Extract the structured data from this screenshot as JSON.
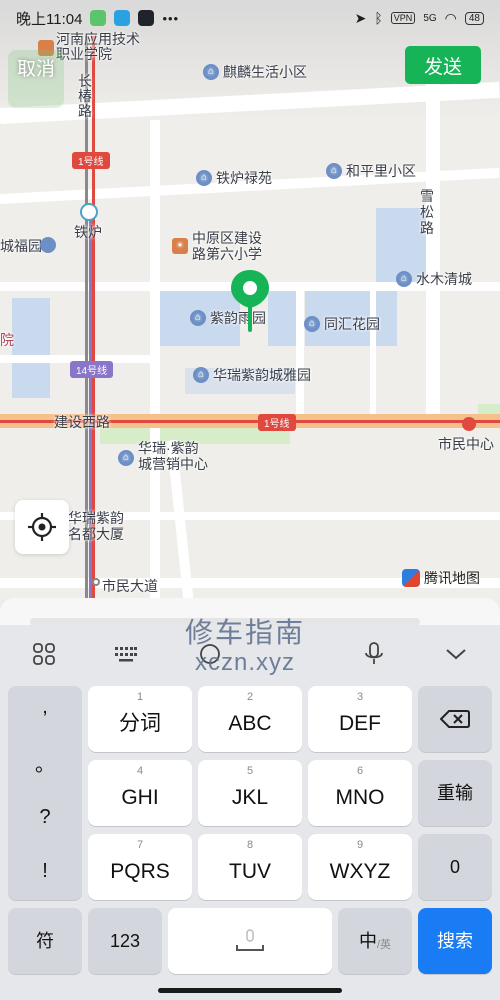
{
  "status_bar": {
    "time": "晚上11:04",
    "dots": "•••",
    "vpn": "VPN",
    "signal": "5G",
    "battery": "48"
  },
  "header": {
    "cancel_label": "取消",
    "send_label": "发送"
  },
  "map": {
    "labels": {
      "school1": "河南应用技术\n职业学院",
      "changchun_road": "长\n椿\n路",
      "xuesong_road": "雪\n松\n路",
      "tielu": "铁炉",
      "fuyuan": "城福园",
      "yuan_edge": "院",
      "jianshexi_road": "建设西路",
      "shiminzhongxin": "市民中心",
      "shimindadao": "市民大道",
      "huarui_dasha": "华瑞紫韵\n名都大厦"
    },
    "pois": {
      "qilin": "麒麟生活小区",
      "tielu_luyuan": "铁炉禄苑",
      "hepingli": "和平里小区",
      "school6": "中原区建设\n路第六小学",
      "shuimu": "水木清城",
      "ziyun": "紫韵雨园",
      "tonghui": "同汇花园",
      "huarui_yayuan": "华瑞紫韵城雅园",
      "huarui_center": "华瑞·紫韵\n城营销中心"
    },
    "metro": {
      "line1_a": "1号线",
      "line1_b": "1号线",
      "line14": "14号线"
    },
    "logo_text": "腾讯地图"
  },
  "watermark": {
    "line1": "修车指南",
    "line2": "xczn.xyz"
  },
  "keyboard": {
    "punct": [
      ",",
      "。",
      "?",
      "!"
    ],
    "row1": [
      {
        "num": "1",
        "label": "分词"
      },
      {
        "num": "2",
        "label": "ABC"
      },
      {
        "num": "3",
        "label": "DEF"
      }
    ],
    "row2": [
      {
        "num": "4",
        "label": "GHI"
      },
      {
        "num": "5",
        "label": "JKL"
      },
      {
        "num": "6",
        "label": "MNO"
      }
    ],
    "row3": [
      {
        "num": "7",
        "label": "PQRS"
      },
      {
        "num": "8",
        "label": "TUV"
      },
      {
        "num": "9",
        "label": "WXYZ"
      }
    ],
    "reinput_label": "重输",
    "zero_label": "0",
    "symbol_label": "符",
    "num_mode_label": "123",
    "lang_main": "中",
    "lang_sub": "/英",
    "search_label": "搜索"
  },
  "colors": {
    "accent_green": "#16b456",
    "search_blue": "#1a7cf5",
    "metro_red": "#e0493f"
  }
}
